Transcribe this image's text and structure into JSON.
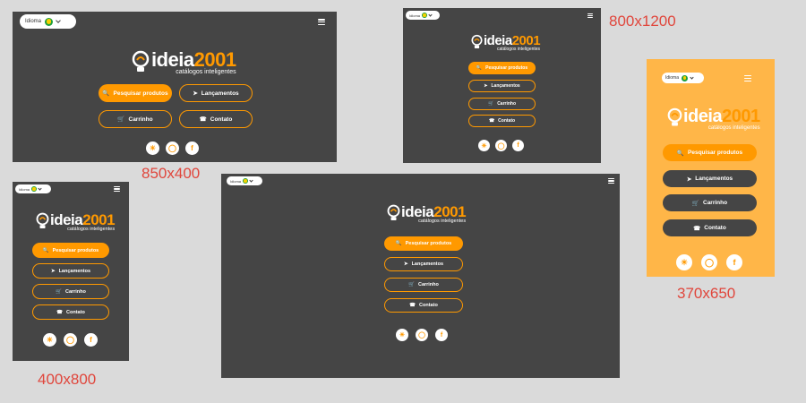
{
  "labels": {
    "s850": "850x400",
    "s800": "800x1200",
    "s400": "400x800",
    "s370": "370x650"
  },
  "language": {
    "label": "Idioma"
  },
  "logo": {
    "brand": "ideia",
    "number": "2001",
    "tagline": "catálogos inteligentes"
  },
  "buttons": {
    "search": "Pesquisar produtos",
    "launches": "Lançamentos",
    "cart": "Carrinho",
    "contact": "Contato"
  },
  "social": {
    "icons": [
      "sun-icon",
      "instagram-icon",
      "facebook-icon"
    ]
  },
  "colors": {
    "dark_bg": "#454545",
    "accent": "#ff9900",
    "orange_bg": "#ffb648",
    "label": "#e0463c"
  }
}
